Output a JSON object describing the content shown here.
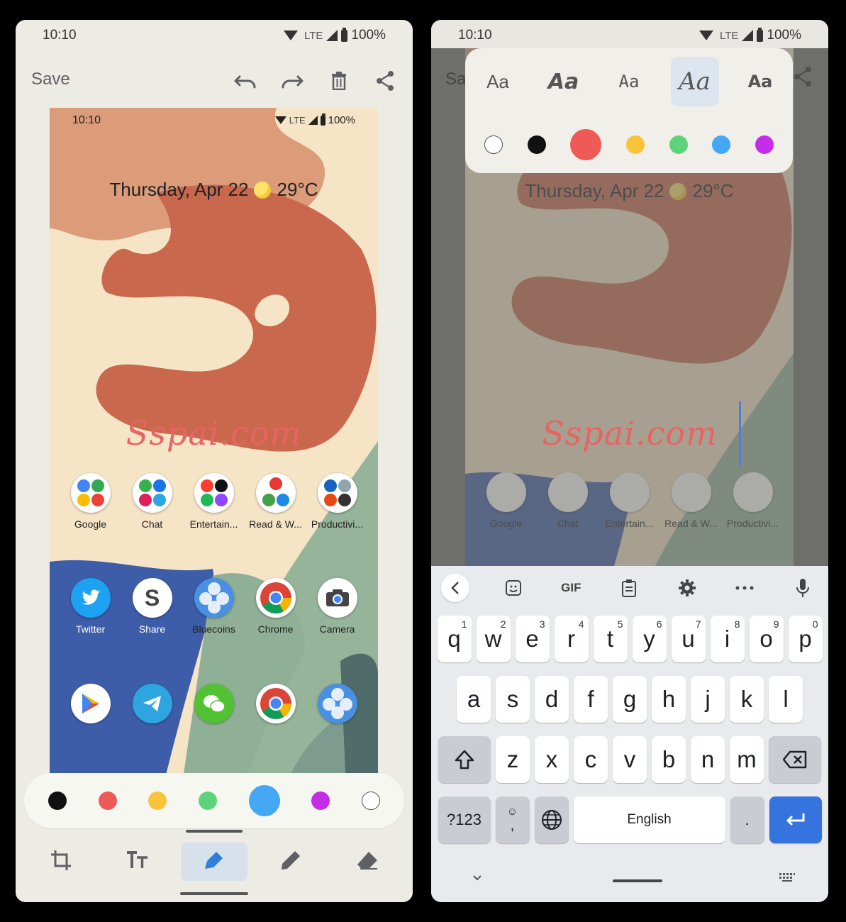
{
  "status_bar": {
    "time": "10:10",
    "network": "LTE",
    "battery": "100%"
  },
  "editor": {
    "save_label": "Save",
    "toolbar_icons": [
      "undo-icon",
      "redo-icon",
      "delete-icon",
      "share-icon"
    ]
  },
  "screenshot": {
    "status_time": "10:10",
    "status_network": "LTE",
    "status_battery": "100%",
    "date_text": "Thursday, Apr 22",
    "temperature": "29°C",
    "annotation_text": "Sspai.com",
    "folder_row": [
      {
        "label": "Google"
      },
      {
        "label": "Chat"
      },
      {
        "label": "Entertain..."
      },
      {
        "label": "Read & W..."
      },
      {
        "label": "Productivi..."
      }
    ],
    "app_row": [
      {
        "label": "Twitter"
      },
      {
        "label": "Share"
      },
      {
        "label": "Bluecoins"
      },
      {
        "label": "Chrome"
      },
      {
        "label": "Camera"
      }
    ],
    "dock_icons": [
      "play-store-icon",
      "telegram-icon",
      "wechat-icon",
      "chrome-icon",
      "bluecoins-icon"
    ]
  },
  "palette_left": {
    "colors": [
      "#111111",
      "#ee5a55",
      "#f9c33a",
      "#5fd37b",
      "#45a8f5",
      "#c42de8",
      "#ffffff"
    ],
    "selected": "#45a8f5"
  },
  "tools": [
    "crop-icon",
    "text-icon",
    "highlighter-icon",
    "pen-icon",
    "eraser-icon"
  ],
  "text_panel": {
    "font_samples": [
      "Aa",
      "Aa",
      "Aa",
      "Aa",
      "Aa"
    ],
    "selected_font_index": 3,
    "colors": [
      "#ffffff",
      "#111111",
      "#ee5a55",
      "#f9c33a",
      "#5fd37b",
      "#45a8f5",
      "#c42de8"
    ],
    "selected": "#ee5a55",
    "save_partial": "Sa"
  },
  "keyboard": {
    "strip": {
      "gif": "GIF"
    },
    "row1": [
      {
        "k": "q",
        "h": "1"
      },
      {
        "k": "w",
        "h": "2"
      },
      {
        "k": "e",
        "h": "3"
      },
      {
        "k": "r",
        "h": "4"
      },
      {
        "k": "t",
        "h": "5"
      },
      {
        "k": "y",
        "h": "6"
      },
      {
        "k": "u",
        "h": "7"
      },
      {
        "k": "i",
        "h": "8"
      },
      {
        "k": "o",
        "h": "9"
      },
      {
        "k": "p",
        "h": "0"
      }
    ],
    "row2": [
      "a",
      "s",
      "d",
      "f",
      "g",
      "h",
      "j",
      "k",
      "l"
    ],
    "row3": [
      "z",
      "x",
      "c",
      "v",
      "b",
      "n",
      "m"
    ],
    "symbols_label": "?123",
    "comma": ",",
    "space_label": "English",
    "period": "."
  }
}
